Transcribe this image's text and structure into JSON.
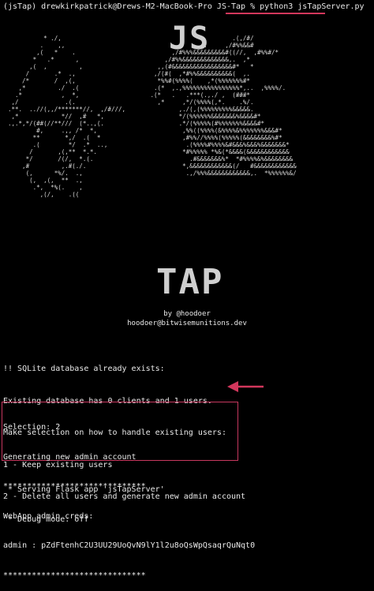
{
  "terminal": {
    "prompt": "(jsTap) drewkirkpatrick@Drews-M2-MacBook-Pro JS-Tap % ",
    "command": "python3 jsTapServer.py"
  },
  "banner": {
    "logo_top": "JS",
    "logo_bottom": "TAP",
    "by_line": "by @hoodoer",
    "email": "hoodoer@bitwisemunitions.dev",
    "art_left": "          * ./,\n         .    ,,\n        ,(   *    .\n       *   .*      ,\n      ,(  ,         ,\n     /       .*  .,\n    /*       /  ,(,\n   ,*         ./  .(\n  .*           ,  *,\n ,/             .(.\n.**.  ..//(,,/*******//,  ,/#///,\n ,*            *//  ,#   *,\n.,.*,*/(##(//**///  (*..,(.\n        #,     .,, /*  *,\n       **       *,/  .(  *\n       .(        */  .*  ..,\n      /       ,(,**  *.*.\n     */       /(/,  *.(.\n    ,#         ,.#(./.\n     (,      *%/.  .,\n      (,  ,(,  **  .,\n       .*,  *%(.    ,\n         ,(/,    .((",
    "art_right": "                        .(,/#/\n             .,,.     ,/#%%&&#\n       ,/#%%%&&&&&&&&&#((//,  ,#%%#/*\n     ,/#%%&&&&&&&&&&&&&,.  ,*\n   ,,(#&&&&&&&&&&&&&&&&&#*   *\n  ,/(#(  ,*#%%&&&&&&&&&&(  ,.\n   *%%#(%%%%(    ,*(%%%%%%%#*\n  .(*  ,.,%%%%%%%%%%%%%%%%*,..  ,%%%%/.\n .(*   .   .***(.,./ ,  (###*\n   ,*     ,*/(%%%%(,*.    .%/.\n         ,./(,(%%%%%%%%%&&&&&.\n         */(%%%%%%&&&&&&&%&&&&#*\n         .*/(%%%%%(#%%%%%%%&&&&#*\n          ,%%((%%%%(&%%%%&%%%%%%%&&&#*\n          ,#%%//%%%%(%%%%%(&&&&&&&&%#*\n           .(%%%%#%%%%&#&&&%&&&%&&&&&&&*\n          *#%%%%% *%&(*&&&&(&&&&&&&&&&&&\n            .#&&&&&&&%*  *#%%%%&%&&&&&&&&\n          *,&&&&&&&&&&&&(/   #&&&&&&&&&&&&\n           .,/%%%&&&&&&&&&&&&,.  *%%%%%%&/"
  },
  "output": {
    "lines": [
      "!! SQLite database already exists:",
      "Existing database has 0 clients and 1 users.",
      "Make selection on how to handle existing users:",
      "1 - Keep existing users",
      "2 - Delete all users and generate new admin account"
    ],
    "selection": [
      "Selection: 2",
      "Generating new admin account",
      "******************************",
      "WebApp admin creds:",
      "admin : pZdFtenhC2U3UU29UoQvN9lY1l2u8oQsWpQsaqrQuNqt0",
      "******************************"
    ],
    "flask": [
      " * Serving Flask app 'jsTapServer'",
      " * Debug mode: off"
    ]
  },
  "colors": {
    "background": "#000000",
    "text": "#e9e9e9",
    "accent": "#d2375c"
  }
}
